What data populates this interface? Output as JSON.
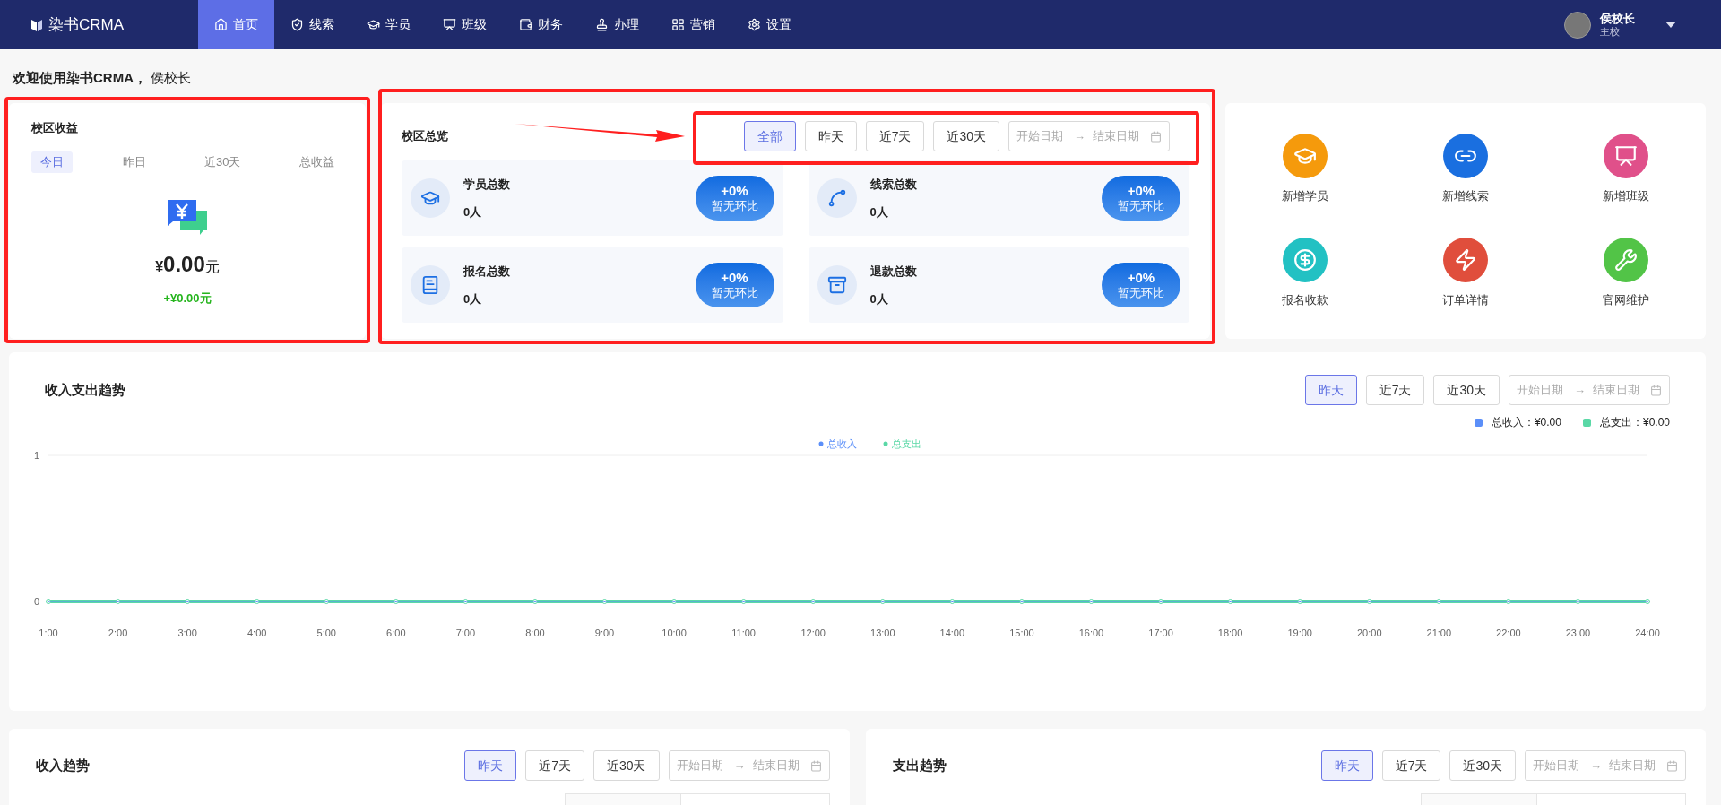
{
  "nav": {
    "logo": "染书CRMA",
    "tabs": [
      {
        "label": "首页",
        "selected": true
      },
      {
        "label": "线索",
        "selected": false
      },
      {
        "label": "学员",
        "selected": false
      },
      {
        "label": "班级",
        "selected": false
      },
      {
        "label": "财务",
        "selected": false
      },
      {
        "label": "办理",
        "selected": false
      },
      {
        "label": "营销",
        "selected": false
      },
      {
        "label": "设置",
        "selected": false
      }
    ],
    "user": {
      "name": "侯校长",
      "role": "主校"
    }
  },
  "welcome": {
    "text": "欢迎使用染书CRMA，",
    "name": "侯校长"
  },
  "revenue": {
    "title": "校区收益",
    "tabs": [
      {
        "label": "今日",
        "selected": true
      },
      {
        "label": "昨日",
        "selected": false
      },
      {
        "label": "近30天",
        "selected": false
      },
      {
        "label": "总收益",
        "selected": false
      }
    ],
    "currency": "¥",
    "amount": "0.00",
    "unit": "元",
    "change": "+¥0.00元"
  },
  "overview": {
    "title": "校区总览",
    "filter": {
      "buttons": [
        {
          "label": "全部",
          "selected": true
        },
        {
          "label": "昨天",
          "selected": false
        },
        {
          "label": "近7天",
          "selected": false
        },
        {
          "label": "近30天",
          "selected": false
        }
      ],
      "start_placeholder": "开始日期",
      "separator": "→",
      "end_placeholder": "结束日期"
    },
    "stats": [
      {
        "label": "学员总数",
        "value": "0人",
        "change": "+0%",
        "note": "暂无环比"
      },
      {
        "label": "线索总数",
        "value": "0人",
        "change": "+0%",
        "note": "暂无环比"
      },
      {
        "label": "报名总数",
        "value": "0人",
        "change": "+0%",
        "note": "暂无环比"
      },
      {
        "label": "退款总数",
        "value": "0人",
        "change": "+0%",
        "note": "暂无环比"
      }
    ]
  },
  "quick_actions": [
    {
      "label": "新增学员",
      "color": "#f59a0c"
    },
    {
      "label": "新增线索",
      "color": "#1a6fe0"
    },
    {
      "label": "新增班级",
      "color": "#e0508a"
    },
    {
      "label": "报名收款",
      "color": "#22c1c3"
    },
    {
      "label": "订单详情",
      "color": "#e04e3c"
    },
    {
      "label": "官网维护",
      "color": "#52c447"
    }
  ],
  "trend": {
    "title": "收入支出趋势",
    "filter": {
      "buttons": [
        {
          "label": "昨天",
          "selected": true
        },
        {
          "label": "近7天",
          "selected": false
        },
        {
          "label": "近30天",
          "selected": false
        }
      ],
      "start_placeholder": "开始日期",
      "separator": "→",
      "end_placeholder": "结束日期"
    },
    "totals": [
      {
        "label": "总收入：¥0.00",
        "color": "#5b8ff9"
      },
      {
        "label": "总支出：¥0.00",
        "color": "#5ad8a6"
      }
    ],
    "chart_data": {
      "type": "line",
      "categories": [
        "1:00",
        "2:00",
        "3:00",
        "4:00",
        "5:00",
        "6:00",
        "7:00",
        "8:00",
        "9:00",
        "10:00",
        "11:00",
        "12:00",
        "13:00",
        "14:00",
        "15:00",
        "16:00",
        "17:00",
        "18:00",
        "19:00",
        "20:00",
        "21:00",
        "22:00",
        "23:00",
        "24:00"
      ],
      "ylim": [
        0,
        1
      ],
      "yticks": [
        0,
        1
      ],
      "series": [
        {
          "name": "总收入",
          "color": "#5b8ff9",
          "marker": true,
          "values": [
            0,
            0,
            0,
            0,
            0,
            0,
            0,
            0,
            0,
            0,
            0,
            0,
            0,
            0,
            0,
            0,
            0,
            0,
            0,
            0,
            0,
            0,
            0,
            0
          ]
        },
        {
          "name": "总支出",
          "color": "#5ad8a6",
          "marker": true,
          "values": [
            0,
            0,
            0,
            0,
            0,
            0,
            0,
            0,
            0,
            0,
            0,
            0,
            0,
            0,
            0,
            0,
            0,
            0,
            0,
            0,
            0,
            0,
            0,
            0
          ]
        }
      ]
    }
  },
  "bottom_panels": [
    {
      "title": "收入趋势",
      "filter": {
        "buttons": [
          {
            "label": "昨天",
            "selected": true
          },
          {
            "label": "近7天",
            "selected": false
          },
          {
            "label": "近30天",
            "selected": false
          }
        ],
        "start_placeholder": "开始日期",
        "separator": "→",
        "end_placeholder": "结束日期"
      }
    },
    {
      "title": "支出趋势",
      "filter": {
        "buttons": [
          {
            "label": "昨天",
            "selected": true
          },
          {
            "label": "近7天",
            "selected": false
          },
          {
            "label": "近30天",
            "selected": false
          }
        ],
        "start_placeholder": "开始日期",
        "separator": "→",
        "end_placeholder": "结束日期"
      }
    }
  ]
}
